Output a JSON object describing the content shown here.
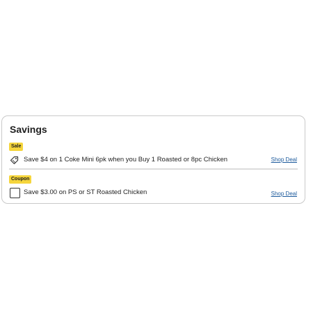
{
  "savings": {
    "title": "Savings",
    "offers": [
      {
        "badge": "Sale",
        "badge_color": "#f5d53c",
        "icon": "tag-icon",
        "text": "Save $4 on 1 Coke Mini 6pk when you Buy 1 Roasted or 8pc Chicken",
        "link": "Shop Deal"
      },
      {
        "badge": "Coupon",
        "badge_color": "#f5d53c",
        "icon": "checkbox",
        "text": "Save $3.00 on PS or ST Roasted Chicken",
        "link": "Shop Deal"
      }
    ]
  },
  "colors": {
    "link": "#1c5a9c",
    "border": "#c9c9c9"
  }
}
